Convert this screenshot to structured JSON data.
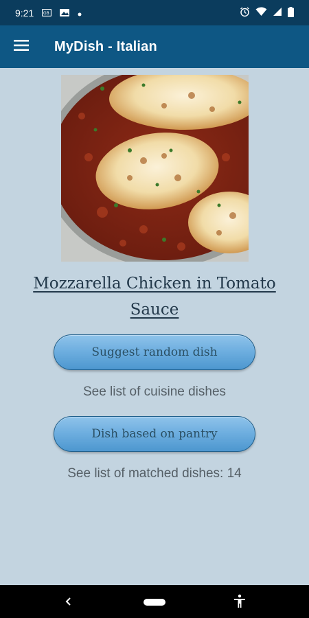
{
  "status_bar": {
    "time": "9:21",
    "icons": [
      "gallery-icon",
      "image-icon",
      "dot-icon",
      "alarm-icon",
      "wifi-icon",
      "signal-icon",
      "battery-icon"
    ]
  },
  "app_bar": {
    "title": "MyDish - Italian",
    "menu_icon": "hamburger-menu-icon"
  },
  "dish": {
    "title": "Mozzarella Chicken in Tomato Sauce",
    "image": "dish-photo"
  },
  "actions": {
    "random_label": "Suggest random dish",
    "cuisine_link": "See list of cuisine dishes",
    "pantry_label": "Dish based on pantry",
    "matched_link": "See list of matched dishes: 14"
  },
  "nav": {
    "icons": [
      "back-icon",
      "home-pill-icon",
      "accessibility-icon"
    ]
  },
  "colors": {
    "status_bar": "#0b3c5d",
    "app_bar": "#0e5784",
    "background": "#c3d4e0",
    "button": "#6fafe0"
  }
}
